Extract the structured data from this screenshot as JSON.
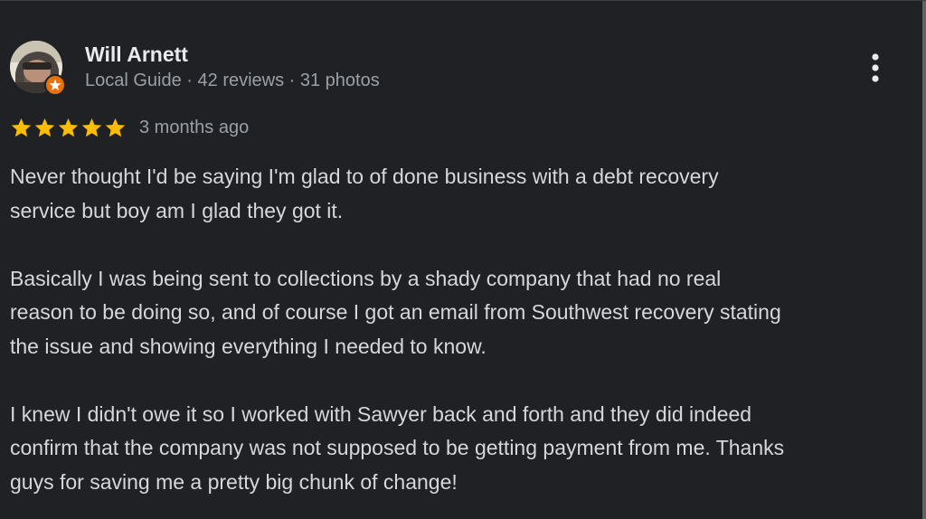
{
  "reviewer": {
    "name": "Will Arnett",
    "meta": "Local Guide · 42 reviews · 31 photos"
  },
  "review": {
    "rating": 5,
    "rating_max": 5,
    "date": "3 months ago",
    "paragraphs": [
      "Never thought I'd be saying I'm glad to of done business with a debt recovery\nservice but boy am I glad they got it.",
      "Basically I was being sent to collections by a shady company that had no real\nreason to be doing so, and of course I got an email from Southwest recovery stating\nthe issue and showing everything I needed to know.",
      "I knew I didn't owe it so I worked with Sawyer back and forth and they did indeed\nconfirm that the company was not supposed to be getting payment from me. Thanks\nguys for saving me a pretty big chunk of change!"
    ]
  },
  "icons": {
    "more": "more-vert-icon",
    "star": "star-icon",
    "badge": "local-guide-badge-icon"
  },
  "colors": {
    "background": "#202124",
    "name_text": "#e8eaed",
    "secondary_text": "#9aa0a6",
    "body_text": "#d5d7da",
    "star": "#fbbc04",
    "badge": "#e8710a"
  }
}
